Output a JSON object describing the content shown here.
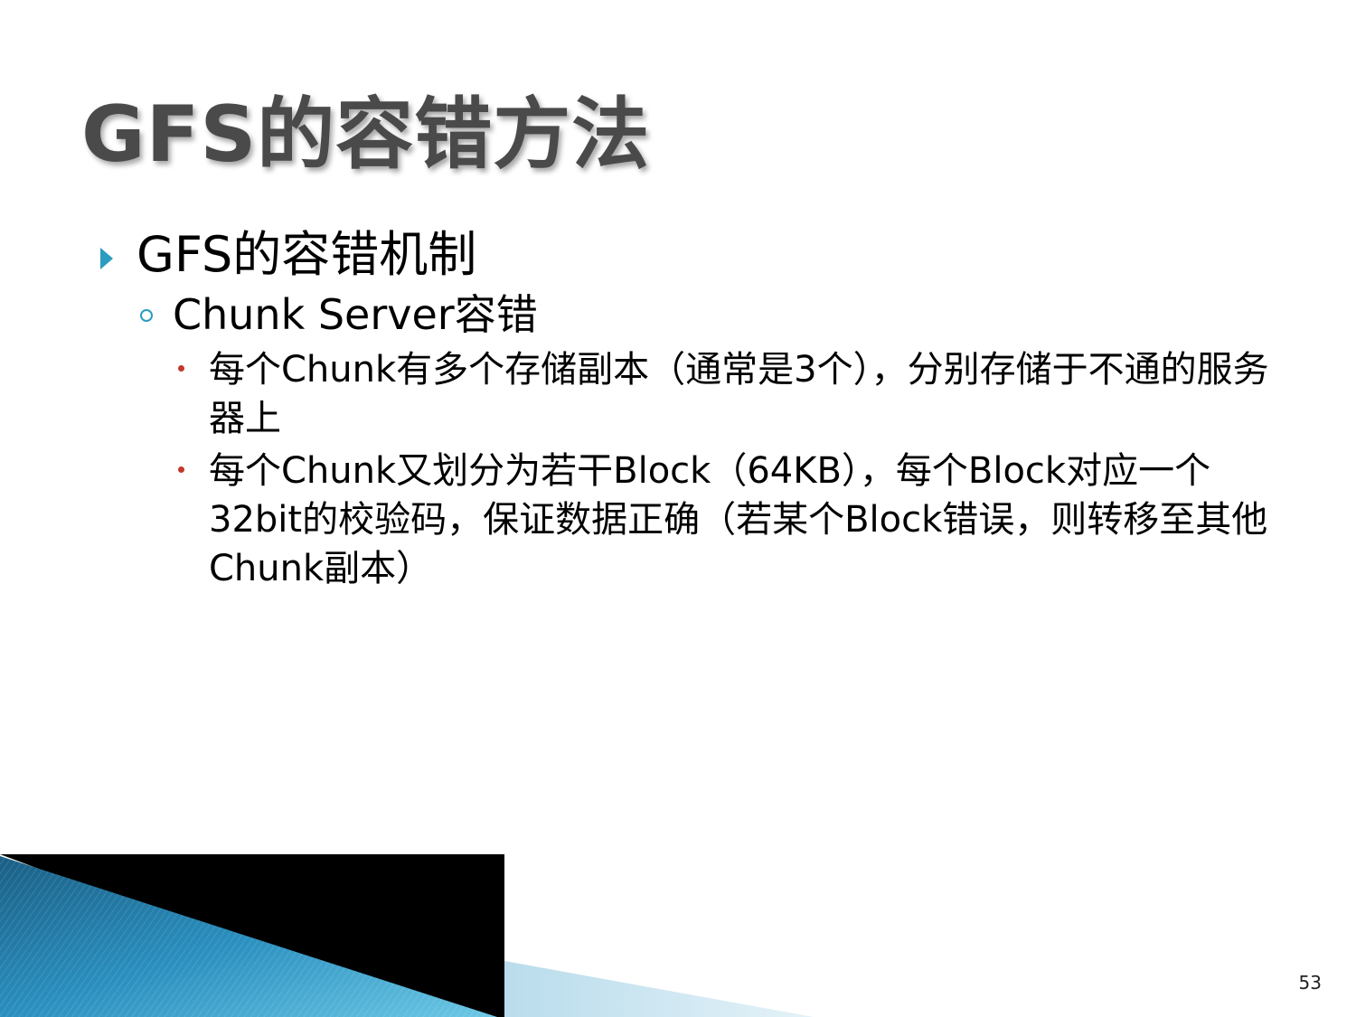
{
  "slide": {
    "title": "GFS的容错方法",
    "level1": "GFS的容错机制",
    "level2": "Chunk Server容错",
    "bullets": [
      "每个Chunk有多个存储副本（通常是3个），分别存储于不通的服务器上",
      "每个Chunk又划分为若干Block（64KB），每个Block对应一个32bit的校验码，保证数据正确（若某个Block错误，则转移至其他Chunk副本）"
    ],
    "page_number": "53"
  },
  "colors": {
    "title": "#4a4a4a",
    "accent_blue": "#2a9cc0",
    "bullet_red": "#c0392b"
  }
}
